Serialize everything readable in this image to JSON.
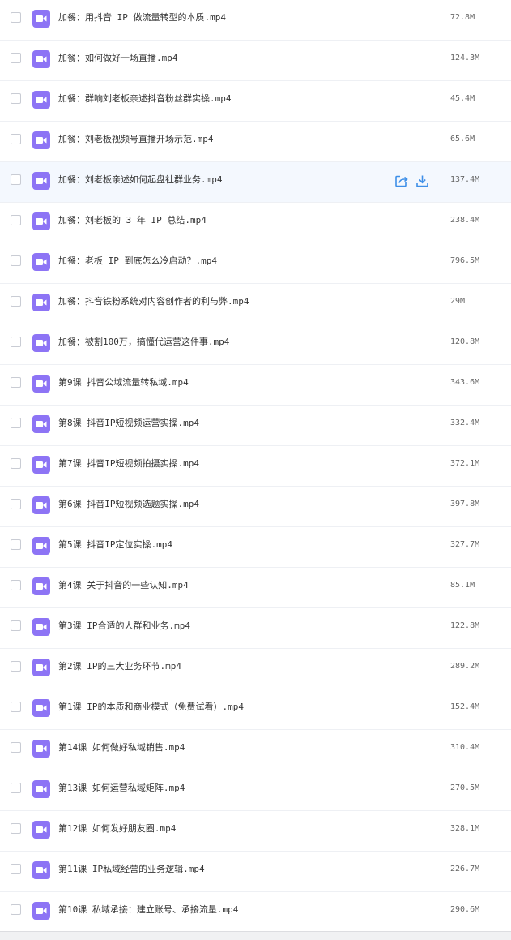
{
  "colors": {
    "video_icon": "#8d74f5",
    "action_icon": "#3e8fe8",
    "hover_row": "#f4f8fe",
    "row_border": "#eef0f4"
  },
  "icons": {
    "file": "video-file-icon",
    "share": "share-icon",
    "download": "download-icon"
  },
  "files": [
    {
      "name": "加餐：用抖音 IP 做流量转型的本质.mp4",
      "size": "72.8M"
    },
    {
      "name": "加餐：如何做好一场直播.mp4",
      "size": "124.3M"
    },
    {
      "name": "加餐：群响刘老板亲述抖音粉丝群实操.mp4",
      "size": "45.4M"
    },
    {
      "name": "加餐：刘老板视频号直播开场示范.mp4",
      "size": "65.6M"
    },
    {
      "name": "加餐：刘老板亲述如何起盘社群业务.mp4",
      "size": "137.4M"
    },
    {
      "name": "加餐：刘老板的 3 年 IP 总结.mp4",
      "size": "238.4M"
    },
    {
      "name": "加餐：老板 IP 到底怎么冷启动？.mp4",
      "size": "796.5M"
    },
    {
      "name": "加餐：抖音铁粉系统对内容创作者的利与弊.mp4",
      "size": "29M"
    },
    {
      "name": "加餐：被割100万，搞懂代运营这件事.mp4",
      "size": "120.8M"
    },
    {
      "name": "第9课 抖音公域流量转私域.mp4",
      "size": "343.6M"
    },
    {
      "name": "第8课 抖音IP短视频运营实操.mp4",
      "size": "332.4M"
    },
    {
      "name": "第7课 抖音IP短视频拍摄实操.mp4",
      "size": "372.1M"
    },
    {
      "name": "第6课 抖音IP短视频选题实操.mp4",
      "size": "397.8M"
    },
    {
      "name": "第5课 抖音IP定位实操.mp4",
      "size": "327.7M"
    },
    {
      "name": "第4课 关于抖音的一些认知.mp4",
      "size": "85.1M"
    },
    {
      "name": "第3课 IP合适的人群和业务.mp4",
      "size": "122.8M"
    },
    {
      "name": "第2课 IP的三大业务环节.mp4",
      "size": "289.2M"
    },
    {
      "name": "第1课 IP的本质和商业模式（免费试看）.mp4",
      "size": "152.4M"
    },
    {
      "name": "第14课 如何做好私域销售.mp4",
      "size": "310.4M"
    },
    {
      "name": "第13课 如何运营私域矩阵.mp4",
      "size": "270.5M"
    },
    {
      "name": "第12课 如何发好朋友圈.mp4",
      "size": "328.1M"
    },
    {
      "name": "第11课 IP私域经营的业务逻辑.mp4",
      "size": "226.7M"
    },
    {
      "name": "第10课 私域承接：建立账号、承接流量.mp4",
      "size": "290.6M"
    }
  ],
  "hovered_row_index": 4
}
